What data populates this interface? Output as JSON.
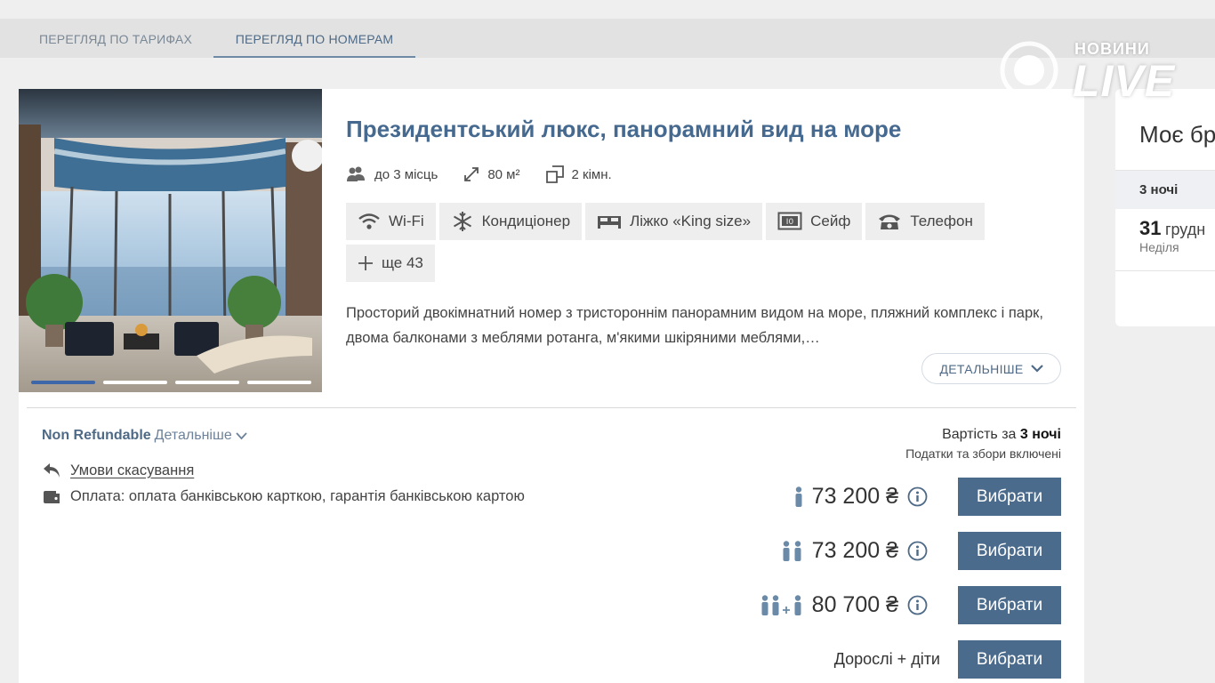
{
  "tabs": [
    {
      "label": "ПЕРЕГЛЯД ПО ТАРИФАХ"
    },
    {
      "label": "ПЕРЕГЛЯД ПО НОМЕРАМ"
    }
  ],
  "room": {
    "title": "Президентський люкс, панорамний вид на море",
    "capacity": "до 3 місць",
    "area": "80 м²",
    "rooms": "2 кімн.",
    "photo_dots": 4,
    "amenities": [
      {
        "label": "Wi-Fi",
        "icon": "wifi-icon"
      },
      {
        "label": "Кондиціонер",
        "icon": "snowflake-icon"
      },
      {
        "label": "Ліжко «King size»",
        "icon": "bed-icon"
      },
      {
        "label": "Сейф",
        "icon": "safe-icon"
      },
      {
        "label": "Телефон",
        "icon": "phone-icon"
      },
      {
        "label": "ще 43",
        "icon": "plus-icon"
      }
    ],
    "description": "Просторий двокімнатний номер з тристороннім панорамним видом на море, пляжний комплекс і парк, двома балконами з меблями ротанга, м'якими шкіряними меблями,…",
    "details_label": "ДЕТАЛЬНІШЕ"
  },
  "rate": {
    "name": "Non Refundable",
    "more_label": "Детальніше",
    "cancellation": "Умови скасування",
    "payment": "Оплата: оплата банківською карткою, гарантія банківською картою"
  },
  "price_header": {
    "cost_prefix": "Вартість за",
    "nights": "3 ночі",
    "taxes": "Податки та збори включені"
  },
  "prices": [
    {
      "guests": "1 adult",
      "amount": "73 200 ₴",
      "button": "Вибрати"
    },
    {
      "guests": "2 adults",
      "amount": "73 200 ₴",
      "button": "Вибрати"
    },
    {
      "guests": "2 adults + 1",
      "amount": "80 700 ₴",
      "button": "Вибрати"
    },
    {
      "guests": "Дорослі + діти",
      "amount": "",
      "button": "Вибрати"
    }
  ],
  "sidebar": {
    "title": "Моє бр",
    "nights": "3 ночі",
    "day": "31",
    "month": "грудн",
    "weekday": "Неділя"
  },
  "watermark": {
    "top": "НОВИНИ",
    "main": "LIVE"
  },
  "colors": {
    "accent": "#45698f",
    "button": "#4b6b8d",
    "chip": "#eeeeee"
  }
}
